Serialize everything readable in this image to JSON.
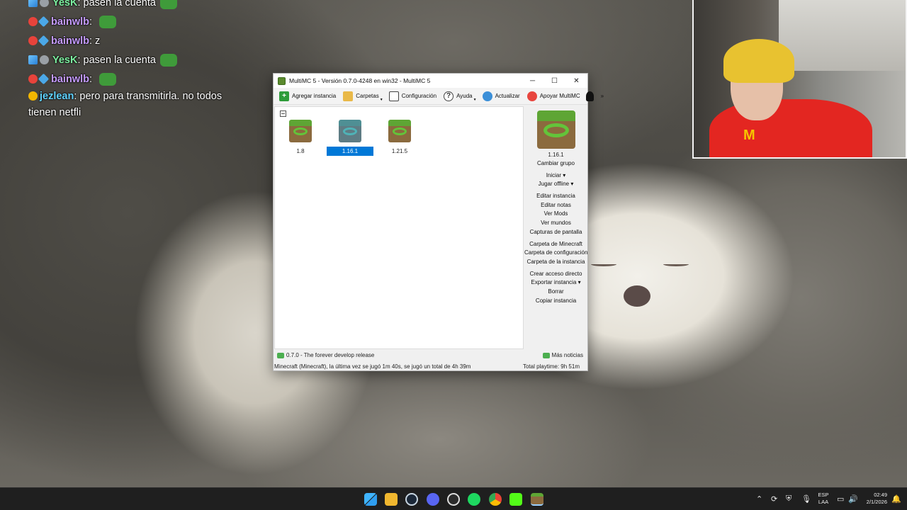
{
  "chat": {
    "messages": [
      {
        "user": "YesK",
        "text": "pasen la cuenta",
        "badges": [
          "sword",
          "gray"
        ],
        "emote": true
      },
      {
        "user": "bainwlb",
        "text": "",
        "badges": [
          "red",
          "blue"
        ],
        "emote": true
      },
      {
        "user": "bainwlb",
        "text": "z",
        "badges": [
          "red",
          "blue"
        ],
        "emote": false
      },
      {
        "user": "YesK",
        "text": "pasen la cuenta",
        "badges": [
          "sword",
          "gray"
        ],
        "emote": true
      },
      {
        "user": "bainwlb",
        "text": "",
        "badges": [
          "red",
          "blue"
        ],
        "emote": true
      },
      {
        "user": "jezlean",
        "text": "pero para transmitirla. no todos tienen netfli",
        "badges": [
          "warn"
        ],
        "emote": false
      }
    ]
  },
  "window": {
    "title": "MultiMC 5 - Versión 0.7.0-4248 en win32 - MultiMC 5",
    "controls": {
      "minimize": "─",
      "maximize": "☐",
      "close": "✕"
    }
  },
  "toolbar": {
    "add_instance": "Agregar instancia",
    "folders": "Carpetas",
    "settings": "Configuración",
    "help": "Ayuda",
    "update": "Actualizar",
    "support": "Apoyar MultiMC",
    "more": "»"
  },
  "instances": [
    {
      "name": "1.8",
      "selected": false,
      "icon": "minecraft-instance-icon"
    },
    {
      "name": "1.16.1",
      "selected": true,
      "icon": "minecraft-instance-icon"
    },
    {
      "name": "1.21.5",
      "selected": false,
      "icon": "minecraft-instance-icon"
    }
  ],
  "side_panel": {
    "selected_name": "1.16.1",
    "change_group": "Cambiar grupo",
    "launch": "Iniciar",
    "play_offline": "Jugar offline",
    "edit_instance": "Editar instancia",
    "edit_notes": "Editar notas",
    "view_mods": "Ver Mods",
    "view_worlds": "Ver mundos",
    "screenshots": "Capturas de pantalla",
    "minecraft_folder": "Carpeta de Minecraft",
    "config_folder": "Carpeta de configuración",
    "instance_folder": "Carpeta de la instancia",
    "create_shortcut": "Crear acceso directo",
    "export_instance": "Exportar instancia",
    "delete": "Borrar",
    "copy_instance": "Copiar instancia"
  },
  "status": {
    "news": "0.7.0 - The forever develop release",
    "more_news": "Más noticias",
    "playtime_info": "Minecraft  (Minecraft), la última vez se jugó 1m 40s, se jugó un total de 4h 39m",
    "total_playtime": "Total playtime: 9h 51m"
  },
  "taskbar": {
    "language": "ESP",
    "layout": "LAA",
    "time": "02:49",
    "date": "2/1/2026",
    "apps": [
      "start-icon",
      "file-explorer-icon",
      "steam-icon",
      "discord-icon",
      "obs-icon",
      "spotify-icon",
      "chrome-icon",
      "kick-icon",
      "multimc-icon"
    ]
  }
}
